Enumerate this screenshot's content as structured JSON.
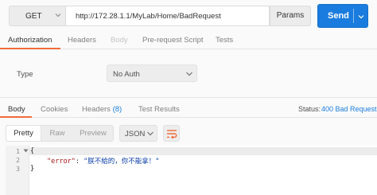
{
  "request": {
    "method": "GET",
    "url": "http://172.28.1.1/MyLab/Home/BadRequest",
    "params_label": "Params",
    "send_label": "Send"
  },
  "request_tabs": [
    {
      "label": "Authorization",
      "active": true
    },
    {
      "label": "Headers"
    },
    {
      "label": "Body",
      "disabled": true
    },
    {
      "label": "Pre-request Script"
    },
    {
      "label": "Tests"
    }
  ],
  "auth": {
    "type_label": "Type",
    "type_value": "No Auth"
  },
  "response_tabs": [
    {
      "label": "Body",
      "active": true
    },
    {
      "label": "Cookies"
    },
    {
      "label": "Headers",
      "count": "(8)"
    },
    {
      "label": "Test Results"
    }
  ],
  "status": {
    "label": "Status:",
    "value": "400 Bad Request"
  },
  "view_modes": [
    "Pretty",
    "Raw",
    "Preview"
  ],
  "format": "JSON",
  "editor": {
    "line_numbers": [
      "1",
      "2",
      "3"
    ],
    "open_brace": "{",
    "key": "\"error\"",
    "colon": ": ",
    "value": "\"朕不給的，你不能拿！\"",
    "close_brace": "}"
  },
  "colors": {
    "accent": "#f26b3a",
    "primary": "#1a7cde"
  },
  "icons": [
    "chevron-down-icon",
    "wrap-lines-icon",
    "fold-arrow-icon"
  ]
}
